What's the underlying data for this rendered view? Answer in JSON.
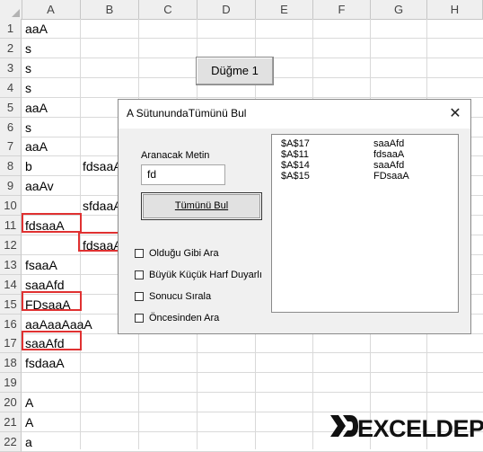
{
  "spreadsheet": {
    "columns": [
      "A",
      "B",
      "C",
      "D",
      "E",
      "F",
      "G",
      "H"
    ],
    "rows": [
      "1",
      "2",
      "3",
      "4",
      "5",
      "6",
      "7",
      "8",
      "9",
      "10",
      "11",
      "12",
      "13",
      "14",
      "15",
      "16",
      "17",
      "18",
      "19",
      "20",
      "21",
      "22"
    ],
    "colA": [
      "aaA",
      "s",
      "s",
      "s",
      "aaA",
      "s",
      "aaA",
      "b",
      "aaAv",
      "",
      "fdsaaA",
      "",
      "fsaaA",
      "saaAfd",
      "FDsaaA",
      "aaAaaAaaA",
      "saaAfd",
      "fsdaaA",
      "",
      "A",
      "A",
      "a"
    ],
    "colB": {
      "8": "fdsaaA",
      "10": "sfdaaA",
      "12": "fdsaaA"
    }
  },
  "sheet_button": {
    "label": "Düğme 1"
  },
  "dialog": {
    "title": "A SütunundaTümünü Bul",
    "close_glyph": "✕",
    "search_label": "Aranacak Metin",
    "search_value": "fd",
    "find_all_label": "Tümünü Bul",
    "options": [
      {
        "label": "Olduğu Gibi Ara",
        "checked": false
      },
      {
        "label": "Büyük Küçük Harf Duyarlı",
        "checked": false
      },
      {
        "label": "Sonucu Sırala",
        "checked": false
      },
      {
        "label": "Öncesinden Ara",
        "checked": false
      }
    ],
    "results": [
      {
        "address": "$A$17",
        "value": "saaAfd"
      },
      {
        "address": "$A$11",
        "value": "fdsaaA"
      },
      {
        "address": "$A$14",
        "value": "saaAfd"
      },
      {
        "address": "$A$15",
        "value": "FDsaaA"
      }
    ]
  },
  "watermark": {
    "text": "EXCELDEPO",
    "icon": "xd-logo-icon",
    "accent": "#111111"
  },
  "highlight_color": "#e03131"
}
